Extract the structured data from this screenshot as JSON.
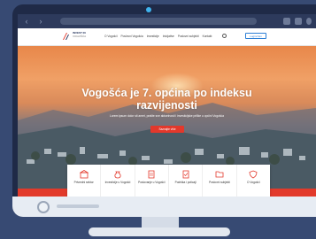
{
  "browser": {
    "back_icon": "chevron-left-icon",
    "forward_icon": "chevron-right-icon"
  },
  "header": {
    "logo_title": "INVEST IN",
    "logo_subtitle": "VOGOŠĆA",
    "nav": [
      "O Vogošći",
      "Poslovni Vogošća",
      "Investicije",
      "Inicijative",
      "Poslovni subjekti",
      "Kontakt",
      "Q"
    ],
    "login_label": "Login/Join"
  },
  "hero": {
    "title": "Vogošća je 7. općina po indeksu razvijenosti",
    "subtitle": "Lorem ipsum dolor sit amet, pratite sve aktuelnosti i investicijske prilike u općini Vogošća",
    "cta_label": "Saznajte više"
  },
  "cards": [
    {
      "icon": "building-icon",
      "label": "Privredni sektor"
    },
    {
      "icon": "money-bag-icon",
      "label": "Investicije u Vogošći"
    },
    {
      "icon": "document-icon",
      "label": "Poslovanje u Vogošći"
    },
    {
      "icon": "checklist-icon",
      "label": "Podrška i poticaji"
    },
    {
      "icon": "folder-icon",
      "label": "Poslovni subjekti"
    },
    {
      "icon": "shield-icon",
      "label": "O Vogošći"
    }
  ],
  "colors": {
    "accent": "#e3382b",
    "link": "#2d7fd6",
    "frame": "#1f2a47",
    "background": "#374a73"
  }
}
